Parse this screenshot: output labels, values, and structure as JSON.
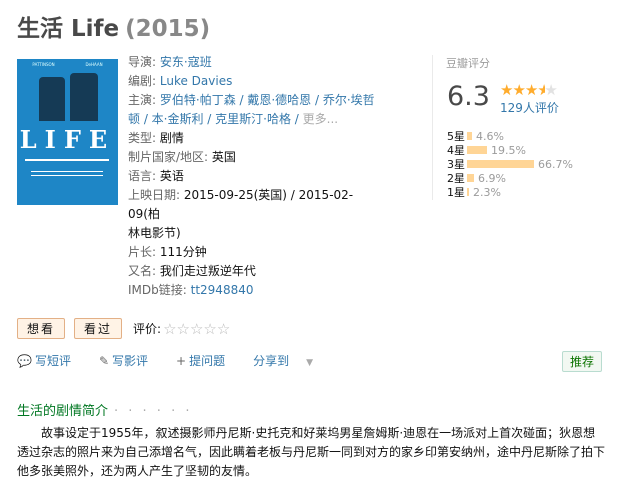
{
  "title": {
    "name": "生活 Life",
    "year": "(2015)"
  },
  "info": {
    "director_label": "导演:",
    "director": "安东·寇班",
    "writer_label": "编剧:",
    "writer": "Luke Davies",
    "cast_label": "主演:",
    "cast_line1": "罗伯特·帕丁森 / 戴恩·德哈恩 / 乔尔·埃哲",
    "cast_line2": "顿 / 本·金斯利 / 克里斯汀·哈格 / ",
    "cast_more": "更多...",
    "genre_label": "类型:",
    "genre": "剧情",
    "country_label": "制片国家/地区:",
    "country": "英国",
    "language_label": "语言:",
    "language": "英语",
    "release_label": "上映日期:",
    "release_line1": "2015-09-25(英国) / 2015-02-09(柏",
    "release_line2": "林电影节)",
    "runtime_label": "片长:",
    "runtime": "111分钟",
    "aka_label": "又名:",
    "aka": "我们走过叛逆年代",
    "imdb_label": "IMDb链接:",
    "imdb": "tt2948840"
  },
  "rating": {
    "label": "豆瓣评分",
    "score": "6.3",
    "stars_filled": 3.5,
    "votes": "129人评价",
    "distribution": [
      {
        "label": "5星",
        "percent": "4.6%",
        "value": 4.6
      },
      {
        "label": "4星",
        "percent": "19.5%",
        "value": 19.5
      },
      {
        "label": "3星",
        "percent": "66.7%",
        "value": 66.7
      },
      {
        "label": "2星",
        "percent": "6.9%",
        "value": 6.9
      },
      {
        "label": "1星",
        "percent": "2.3%",
        "value": 2.3
      }
    ]
  },
  "actions": {
    "want": "想看",
    "seen": "看过",
    "rate_label": "评价:"
  },
  "links": {
    "short_review": "写短评",
    "review": "写影评",
    "question": "提问题",
    "share": "分享到",
    "recommend": "推荐"
  },
  "synopsis": {
    "heading": "生活的剧情简介",
    "dots": "· · · · · ·",
    "text": "故事设定于1955年，叙述摄影师丹尼斯·史托克和好莱坞男星詹姆斯·迪恩在一场派对上首次碰面；狄恩想透过杂志的照片来为自己添增名气，因此瞒着老板与丹尼斯一同到对方的家乡印第安纳州，途中丹尼斯除了拍下他多张美照外，还为两人产生了坚韧的友情。"
  },
  "poster": {
    "names": [
      "PATTINSON",
      "DeHAAN"
    ],
    "title": "LIFE"
  },
  "colors": {
    "link": "#3377aa",
    "accent_green": "#007722",
    "star": "#ffac2d",
    "bar": "#ffd596"
  }
}
